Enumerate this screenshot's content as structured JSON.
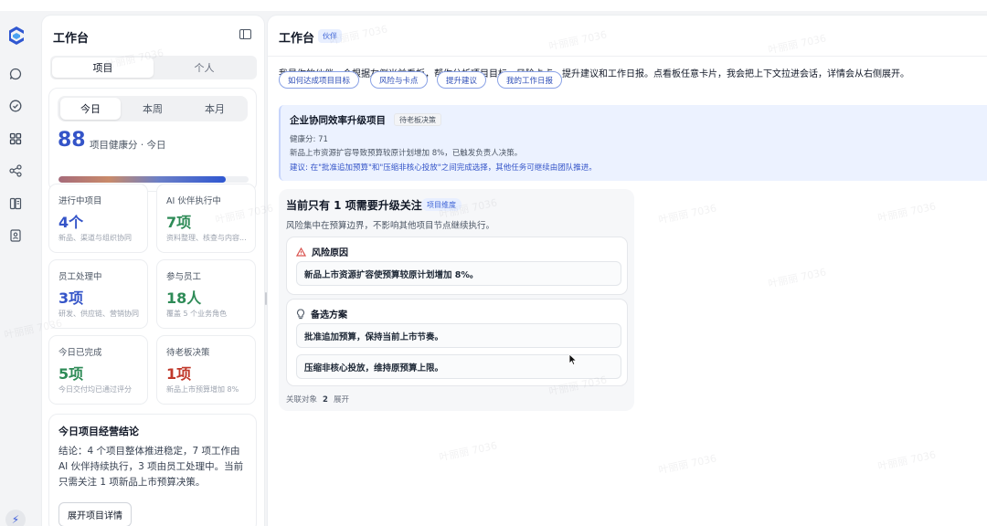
{
  "left_panel": {
    "title": "工作台",
    "tabs": [
      "项目",
      "个人"
    ],
    "period_tabs": [
      "今日",
      "本周",
      "本月"
    ],
    "health_score": "88",
    "health_label": "项目健康分 · 今日",
    "health_progress": 0.88,
    "stats": [
      {
        "title": "进行中项目",
        "value": "4个",
        "desc": "新品、渠道与组织协同",
        "color": "#3454c8"
      },
      {
        "title": "AI 伙伴执行中",
        "value": "7项",
        "desc": "资料整理、核查与内容...",
        "color": "#2e8b57"
      },
      {
        "title": "员工处理中",
        "value": "3项",
        "desc": "研发、供应链、营销协同",
        "color": "#3454c8"
      },
      {
        "title": "参与员工",
        "value": "18人",
        "desc": "覆盖 5 个业务角色",
        "color": "#2e8b57"
      },
      {
        "title": "今日已完成",
        "value": "5项",
        "desc": "今日交付均已通过评分",
        "color": "#2e8b57"
      },
      {
        "title": "待老板决策",
        "value": "1项",
        "desc": "新品上市预算增加 8%",
        "color": "#c0392b"
      }
    ],
    "summary": {
      "title": "今日项目经营结论",
      "body": "结论：4 个项目整体推进稳定，7 项工作由 AI 伙伴持续执行，3 项由员工处理中。当前只需关注 1 项新品上市预算决策。",
      "button": "展开项目详情"
    }
  },
  "main_panel": {
    "title": "工作台",
    "badge": "伙伴",
    "intro": "我是你的伙伴，会根据左侧当前看板，帮你分析项目目标、风险卡点、提升建议和工作日报。点看板任意卡片，我会把上下文拉进会话，详情会从右侧展开。",
    "chips": [
      "如何达成项目目标",
      "风险与卡点",
      "提升建议",
      "我的工作日报"
    ],
    "project": {
      "title": "企业协同效率升级项目",
      "badge": "待老板决策",
      "health": "健康分: 71",
      "line": "新品上市资源扩容导致预算较原计划增加 8%，已触发负责人决策。",
      "advice": "建议: 在\"批准追加预算\"和\"压缩非核心投放\"之间完成选择，其他任务可继续由团队推进。"
    },
    "risk_card": {
      "title": "当前只有 1 项需要升级关注",
      "badge": "项目维度",
      "subtitle": "风险集中在预算边界，不影响其他项目节点继续执行。",
      "reason_title": "风险原因",
      "reason": "新品上市资源扩容使预算较原计划增加 8%。",
      "options_title": "备选方案",
      "option_1": "批准追加预算，保持当前上市节奏。",
      "option_2": "压缩非核心投放，维持原预算上限。",
      "footer_label": "关联对象",
      "footer_count": "2",
      "footer_action": "展开"
    }
  },
  "watermark": "叶丽丽 7036"
}
